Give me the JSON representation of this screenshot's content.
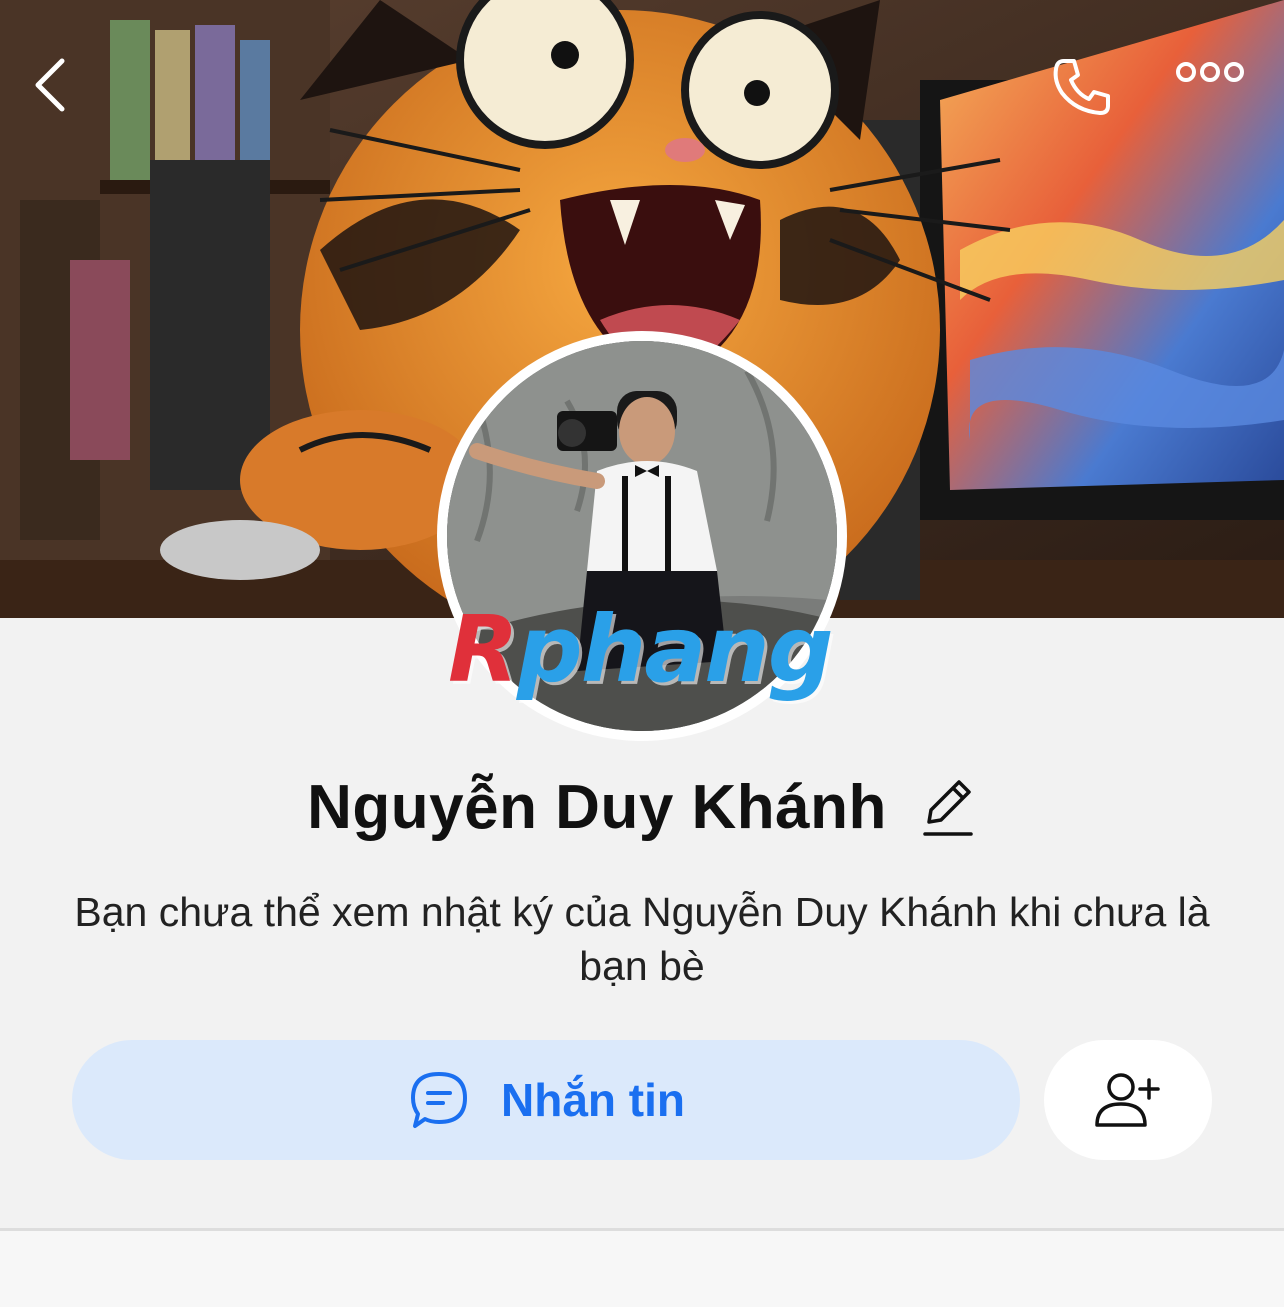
{
  "header": {
    "back_icon": "chevron-left-icon",
    "call_icon": "phone-icon",
    "more_icon": "more-dots-icon"
  },
  "profile": {
    "name": "Nguyễn Duy Khánh",
    "edit_icon": "pencil-icon",
    "notice": "Bạn chưa thể xem nhật ký của Nguyễn Duy Khánh khi chưa là bạn bè",
    "watermark_r": "R",
    "watermark_rest": "phang"
  },
  "actions": {
    "message_label": "Nhắn tin",
    "message_icon": "chat-bubble-icon",
    "add_friend_icon": "add-friend-icon"
  },
  "colors": {
    "accent": "#1a6ff0",
    "message_button_bg": "#dbe9fb",
    "background": "#f2f2f2"
  }
}
